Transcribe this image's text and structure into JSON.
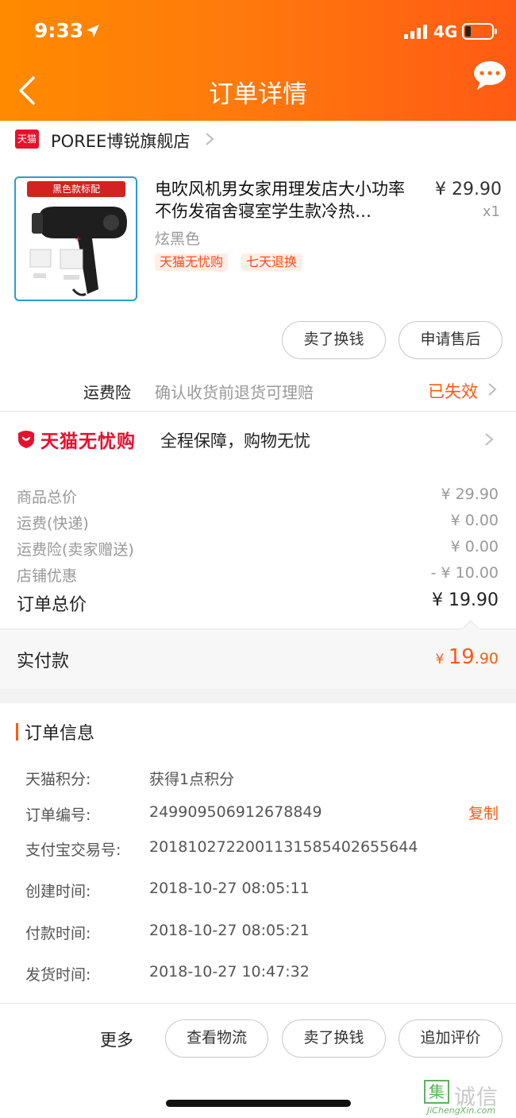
{
  "status_bar": {
    "time": "9:33",
    "network": "4G"
  },
  "header": {
    "title": "订单详情"
  },
  "store": {
    "badge": "天猫",
    "name": "POREE博锐旗舰店"
  },
  "product": {
    "thumb_banner": "黑色款标配",
    "title": "电吹风机男女家用理发店大小功率不伤发宿舍寝室学生款冷热…",
    "price": "¥ 29.90",
    "qty": "x1",
    "variant": "炫黑色",
    "tags": [
      "天猫无忧购",
      "七天退换"
    ],
    "actions": [
      "卖了换钱",
      "申请售后"
    ]
  },
  "insurance": {
    "label": "运费险",
    "desc": "确认收货前退货可理赔",
    "status": "已失效"
  },
  "guarantee": {
    "brand": "天猫无忧购",
    "text": "全程保障，购物无忧"
  },
  "price_breakdown": [
    {
      "label": "商品总价",
      "value": "¥ 29.90"
    },
    {
      "label": "运费(快递)",
      "value": "¥ 0.00"
    },
    {
      "label": "运费险(卖家赠送)",
      "value": "¥ 0.00"
    },
    {
      "label": "店铺优惠",
      "value": "- ¥ 10.00"
    }
  ],
  "order_total": {
    "label": "订单总价",
    "value": "¥ 19.90"
  },
  "paid": {
    "label": "实付款",
    "yen": "¥ ",
    "int": "19",
    "dec": ".90"
  },
  "order_info": {
    "title": "订单信息",
    "copy_label": "复制",
    "rows": [
      {
        "label": "天猫积分:",
        "value": "获得1点积分"
      },
      {
        "label": "订单编号:",
        "value": "249909506912678849"
      },
      {
        "label": "支付宝交易号:",
        "value": "2018102722001131585402655644"
      },
      {
        "label": "创建时间:",
        "value": "2018-10-27 08:05:11"
      },
      {
        "label": "付款时间:",
        "value": "2018-10-27 08:05:21"
      },
      {
        "label": "发货时间:",
        "value": "2018-10-27 10:47:32"
      }
    ]
  },
  "bottom_bar": {
    "more": "更多",
    "actions": [
      "查看物流",
      "卖了换钱",
      "追加评价"
    ]
  },
  "watermark": {
    "box": "集",
    "text": "诚信",
    "sub": "JiChengXin.com"
  },
  "colors": {
    "accent": "#ff5a14",
    "tmall_red": "#e8102c",
    "header_start": "#ff8a00",
    "header_end": "#ff5a14"
  }
}
